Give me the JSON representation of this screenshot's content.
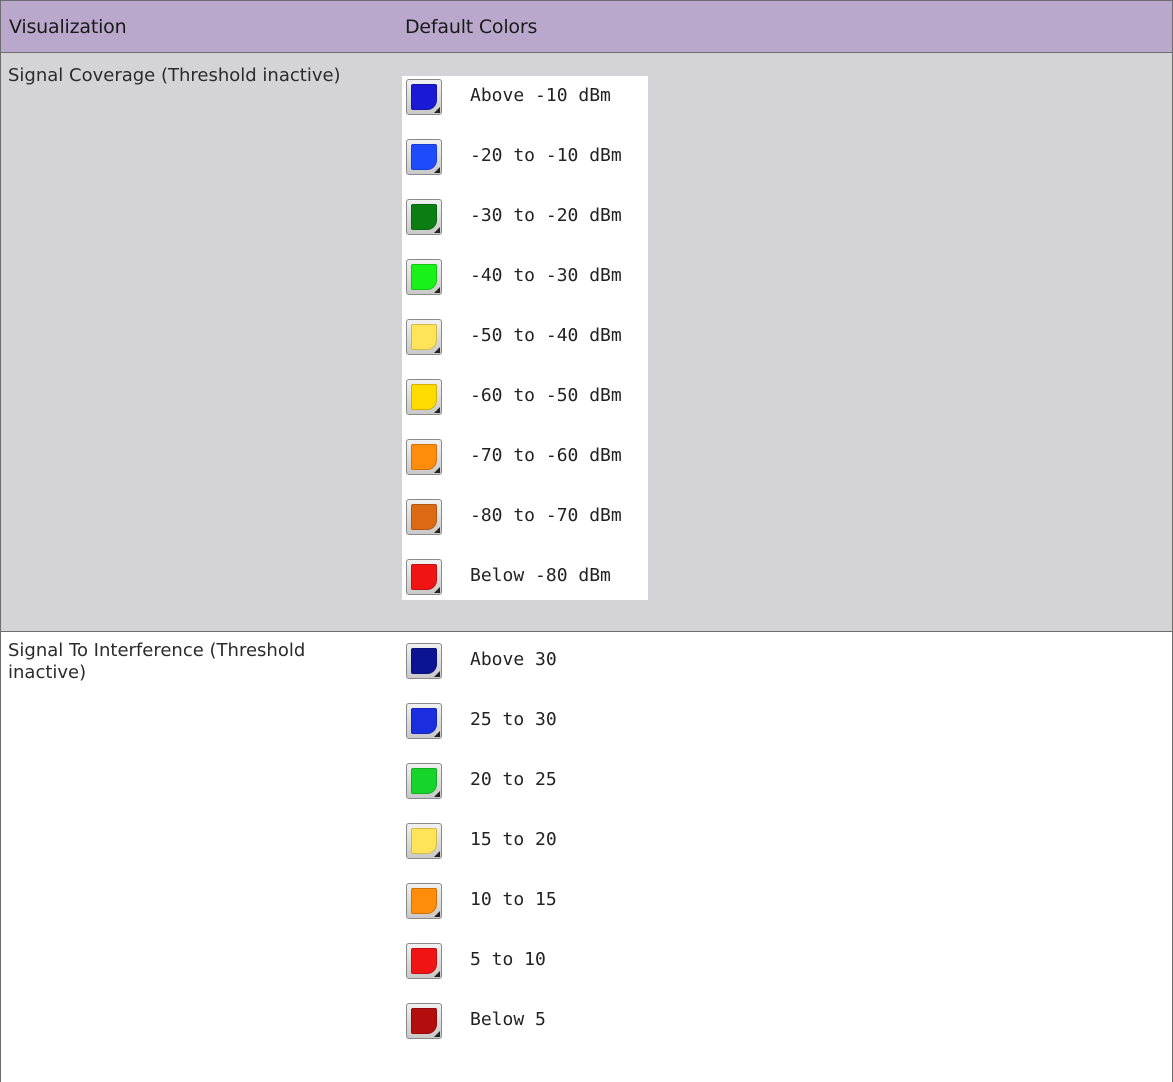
{
  "header": {
    "col1": "Visualization",
    "col2": "Default Colors"
  },
  "rows": [
    {
      "label": "Signal Coverage (Threshold inactive)",
      "legend": [
        {
          "label": "Above -10 dBm",
          "color": "#1a1ad4"
        },
        {
          "label": "-20 to -10 dBm",
          "color": "#1f4bff"
        },
        {
          "label": "-30 to -20 dBm",
          "color": "#0c7d12"
        },
        {
          "label": "-40 to -30 dBm",
          "color": "#19f219"
        },
        {
          "label": "-50 to -40 dBm",
          "color": "#ffe45a"
        },
        {
          "label": "-60 to -50 dBm",
          "color": "#ffdb00"
        },
        {
          "label": "-70 to -60 dBm",
          "color": "#ff8c0a"
        },
        {
          "label": "-80 to -70 dBm",
          "color": "#dc6a14"
        },
        {
          "label": "Below -80 dBm",
          "color": "#f01414"
        }
      ]
    },
    {
      "label": "Signal To Interference (Threshold inactive)",
      "legend": [
        {
          "label": "Above 30",
          "color": "#0b1594"
        },
        {
          "label": "25 to 30",
          "color": "#1a2ee0"
        },
        {
          "label": "20 to 25",
          "color": "#16d42a"
        },
        {
          "label": "15 to 20",
          "color": "#ffe45a"
        },
        {
          "label": "10 to 15",
          "color": "#ff8c0a"
        },
        {
          "label": "5 to 10",
          "color": "#f01414"
        },
        {
          "label": "Below 5",
          "color": "#b40d0d"
        }
      ]
    }
  ]
}
